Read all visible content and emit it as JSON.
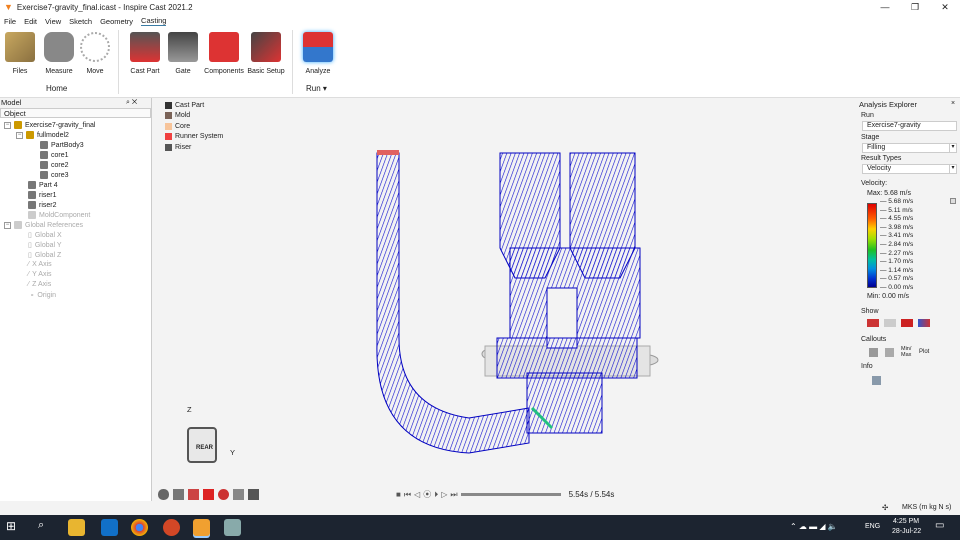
{
  "window": {
    "title": "Exercise7-gravity_final.icast - Inspire Cast 2021.2"
  },
  "menu": [
    "File",
    "Edit",
    "View",
    "Sketch",
    "Geometry",
    "Casting"
  ],
  "ribbon": {
    "home": [
      "Files",
      "Measure",
      "Move"
    ],
    "home_group": "Home",
    "casting": [
      "Cast Part",
      "Gate",
      "Components",
      "Basic Setup"
    ],
    "run": [
      "Analyze"
    ],
    "run_group": "Run"
  },
  "model_panel": {
    "title": "Model",
    "column": "Object",
    "tree": [
      "Exercise7-gravity_final",
      "fullmodel2",
      "PartBody3",
      "core1",
      "core2",
      "core3",
      "Part 4",
      "riser1",
      "riser2",
      "MoldComponent",
      "Global References",
      "Global X",
      "Global Y",
      "Global Z",
      "X Axis",
      "Y Axis",
      "Z Axis",
      "Origin"
    ]
  },
  "legend": [
    {
      "label": "Cast Part",
      "color": "#333333"
    },
    {
      "label": "Mold",
      "color": "#7a6358"
    },
    {
      "label": "Core",
      "color": "#f7c49a"
    },
    {
      "label": "Runner System",
      "color": "#f04040"
    },
    {
      "label": "Riser",
      "color": "#555555"
    }
  ],
  "analysis": {
    "title": "Analysis Explorer",
    "run_label": "Run",
    "run_value": "Exercise7-gravity",
    "stage_label": "Stage",
    "stage_value": "Filling",
    "result_label": "Result Types",
    "result_value": "Velocity",
    "scale_title": "Velocity:",
    "max": "Max:  5.68 m/s",
    "min": "Min:  0.00 m/s",
    "ticks": [
      "5.68 m/s",
      "5.11 m/s",
      "4.55 m/s",
      "3.98 m/s",
      "3.41 m/s",
      "2.84 m/s",
      "2.27 m/s",
      "1.70 m/s",
      "1.14 m/s",
      "0.57 m/s",
      "0.00 m/s"
    ],
    "show": "Show",
    "callouts": "Callouts",
    "minmax": "Min/ Max",
    "plot": "Plot",
    "info": "Info"
  },
  "viewcube": {
    "face": "REAR",
    "z": "Z",
    "y": "Y"
  },
  "playback": {
    "time": "5.54s / 5.54s",
    "progress": 1.0
  },
  "status": {
    "units": "MKS (m kg N s)"
  },
  "taskbar": {
    "lang": "ENG",
    "time": "4:25 PM",
    "date": "28-Jul-22"
  }
}
